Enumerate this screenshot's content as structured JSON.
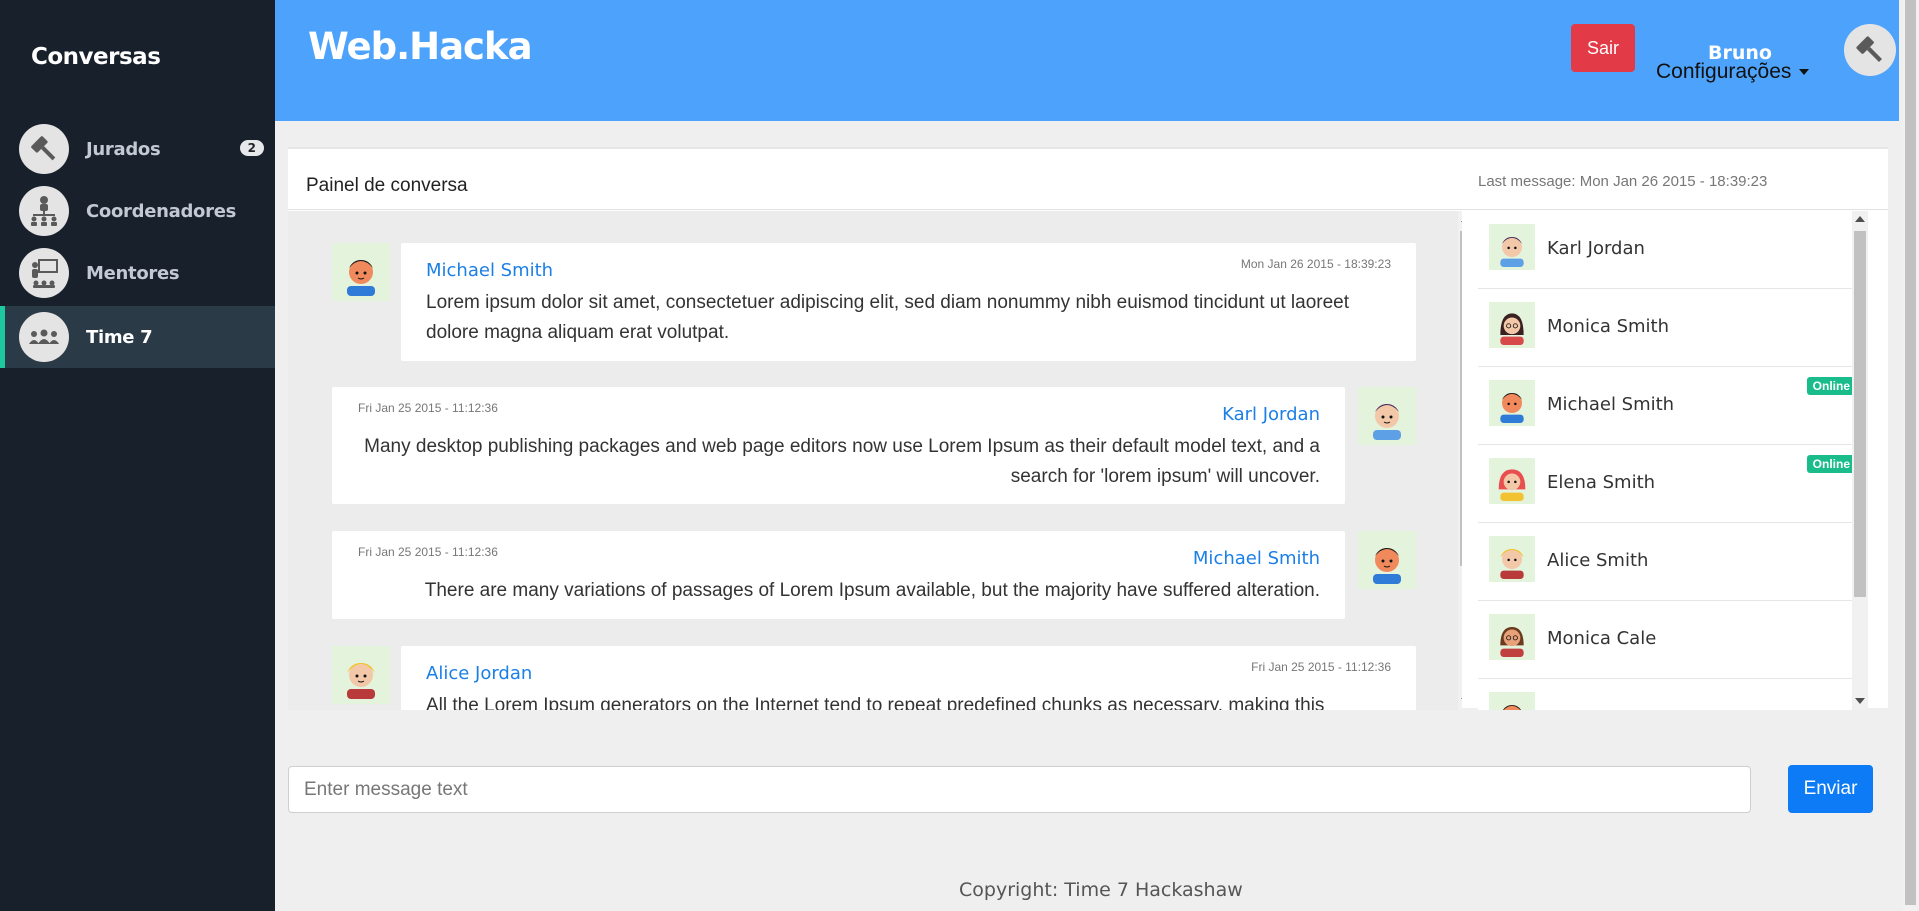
{
  "sidebar": {
    "title": "Conversas",
    "items": [
      {
        "label": "Jurados",
        "badge": "2",
        "icon": "gavel-icon"
      },
      {
        "label": "Coordenadores",
        "icon": "hierarchy-icon"
      },
      {
        "label": "Mentores",
        "icon": "presentation-icon"
      },
      {
        "label": "Time 7",
        "icon": "team-icon",
        "active": true
      }
    ]
  },
  "header": {
    "brand": "Web.Hacka",
    "logout_label": "Sair",
    "user_name": "Bruno",
    "settings_label": "Configurações",
    "bg_color": "#4da3fb"
  },
  "panel": {
    "title": "Painel de conversa",
    "last_message": "Last message: Mon Jan 26 2015 - 18:39:23"
  },
  "messages": [
    {
      "author": "Michael Smith",
      "time": "Mon Jan 26 2015 - 18:39:23",
      "text": "Lorem ipsum dolor sit amet, consectetuer adipiscing elit, sed diam nonummy nibh euismod tincidunt ut laoreet dolore magna aliquam erat volutpat.",
      "side": "left"
    },
    {
      "author": "Karl Jordan",
      "time": "Fri Jan 25 2015 - 11:12:36",
      "text": "Many desktop publishing packages and web page editors now use Lorem Ipsum as their default model text, and a search for 'lorem ipsum' will uncover.",
      "side": "right"
    },
    {
      "author": "Michael Smith",
      "time": "Fri Jan 25 2015 - 11:12:36",
      "text": "There are many variations of passages of Lorem Ipsum available, but the majority have suffered alteration.",
      "side": "right"
    },
    {
      "author": "Alice Jordan",
      "time": "Fri Jan 25 2015 - 11:12:36",
      "text": "All the Lorem Ipsum generators on the Internet tend to repeat predefined chunks as necessary, making this",
      "side": "left"
    }
  ],
  "users": [
    {
      "name": "Karl Jordan",
      "online": false
    },
    {
      "name": "Monica Smith",
      "online": false
    },
    {
      "name": "Michael Smith",
      "online": true,
      "status": "Online"
    },
    {
      "name": "Elena Smith",
      "online": true,
      "status": "Online"
    },
    {
      "name": "Alice Smith",
      "online": false
    },
    {
      "name": "Monica Cale",
      "online": false
    }
  ],
  "composer": {
    "placeholder": "Enter message text",
    "send_label": "Enviar"
  },
  "footer": {
    "text": "Copyright: Time 7 Hackashaw"
  }
}
